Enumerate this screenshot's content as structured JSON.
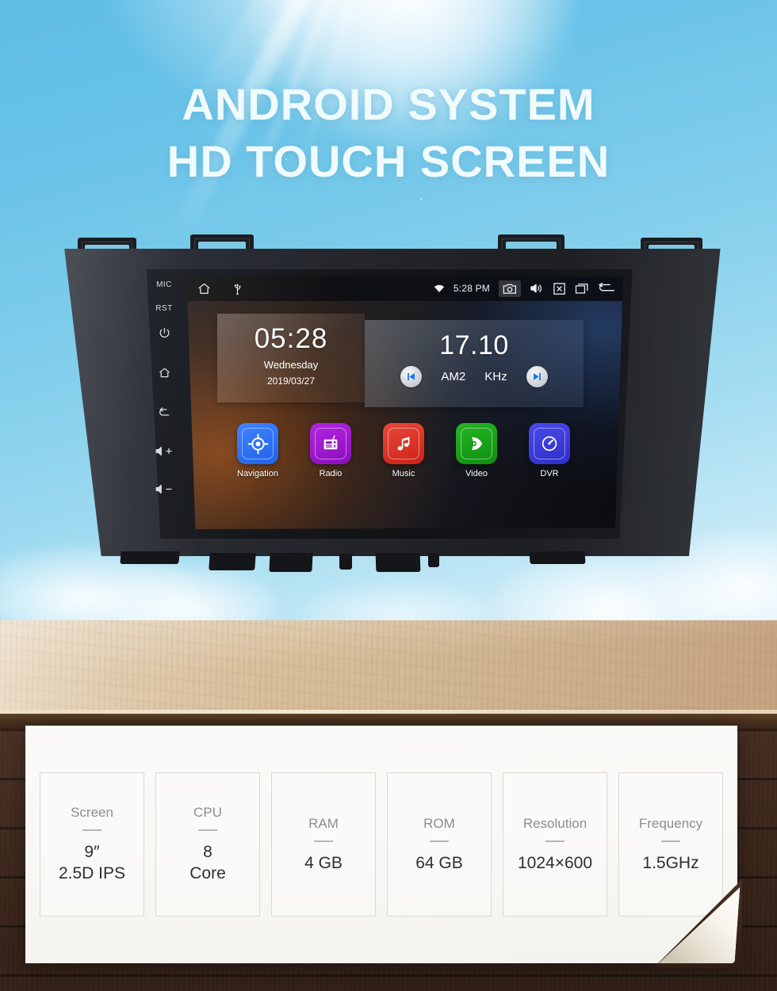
{
  "hero": {
    "headline_line1": "ANDROID SYSTEM",
    "headline_line2": "HD TOUCH SCREEN"
  },
  "head_unit": {
    "side_keys": [
      {
        "name": "mic",
        "label": "MIC",
        "type": "text"
      },
      {
        "name": "reset",
        "label": "RST",
        "type": "text"
      },
      {
        "name": "power",
        "label": "",
        "type": "icon"
      },
      {
        "name": "home",
        "label": "",
        "type": "icon"
      },
      {
        "name": "back",
        "label": "",
        "type": "icon"
      },
      {
        "name": "volume-up",
        "label": "",
        "type": "icon"
      },
      {
        "name": "volume-down",
        "label": "",
        "type": "icon"
      }
    ],
    "status_bar": {
      "time": "5:28 PM",
      "icons_left": [
        "home-icon",
        "usb-icon"
      ],
      "icons_right": [
        "wifi-icon",
        "camera-icon",
        "volume-icon",
        "close-icon",
        "recents-icon",
        "back-icon"
      ]
    },
    "clock_widget": {
      "time": "05:28",
      "weekday": "Wednesday",
      "date": "2019/03/27"
    },
    "radio_widget": {
      "frequency": "17.10",
      "band": "AM2",
      "unit": "KHz",
      "prev_label": "prev-track-icon",
      "next_label": "next-track-icon"
    },
    "apps": [
      {
        "label": "Navigation",
        "icon": "navigation-icon",
        "color": "#2a6ff0"
      },
      {
        "label": "Radio",
        "icon": "radio-icon",
        "color": "#9a17c4"
      },
      {
        "label": "Music",
        "icon": "music-icon",
        "color": "#d93025"
      },
      {
        "label": "Video",
        "icon": "video-icon",
        "color": "#19a319"
      },
      {
        "label": "DVR",
        "icon": "dvr-icon",
        "color": "#3b3bd8"
      }
    ]
  },
  "specs": [
    {
      "label": "Screen",
      "value": "9″\n2.5D IPS"
    },
    {
      "label": "CPU",
      "value": "8\nCore"
    },
    {
      "label": "RAM",
      "value": "4 GB"
    },
    {
      "label": "ROM",
      "value": "64 GB"
    },
    {
      "label": "Resolution",
      "value": "1024×600"
    },
    {
      "label": "Frequency",
      "value": "1.5GHz"
    }
  ]
}
